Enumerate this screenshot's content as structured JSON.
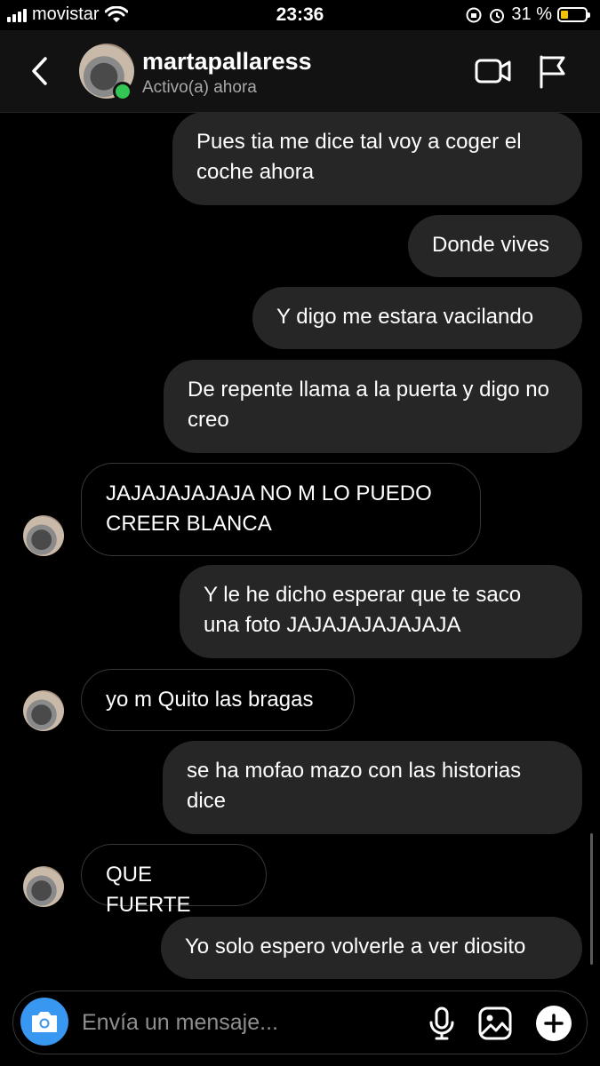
{
  "status_bar": {
    "carrier": "movistar",
    "time": "23:36",
    "battery_text": "31 %",
    "battery_level": 0.31
  },
  "header": {
    "username": "martapallaress",
    "status": "Activo(a) ahora"
  },
  "messages": [
    {
      "direction": "outgoing",
      "text": "Pues tia me dice tal voy a coger el coche ahora"
    },
    {
      "direction": "outgoing",
      "text": "Donde vives"
    },
    {
      "direction": "outgoing",
      "text": "Y digo me estara vacilando"
    },
    {
      "direction": "outgoing",
      "text": "De repente llama a la puerta y digo no creo"
    },
    {
      "direction": "incoming",
      "text": "JAJAJAJAJAJA NO M LO PUEDO CREER BLANCA"
    },
    {
      "direction": "outgoing",
      "text": "Y le he dicho esperar que te saco una foto JAJAJAJAJAJAJA"
    },
    {
      "direction": "incoming",
      "text": "yo m Quito las bragas"
    },
    {
      "direction": "outgoing",
      "text": "se ha mofao mazo con las historias dice"
    },
    {
      "direction": "incoming",
      "text": "QUE FUERTE"
    },
    {
      "direction": "outgoing",
      "text": "Yo solo espero volverle a ver diosito"
    }
  ],
  "composer": {
    "placeholder": "Envía un mensaje..."
  },
  "colors": {
    "outgoing_bubble": "#262626",
    "camera_button": "#3897f0",
    "online": "#33c653",
    "battery": "#f4c300"
  }
}
